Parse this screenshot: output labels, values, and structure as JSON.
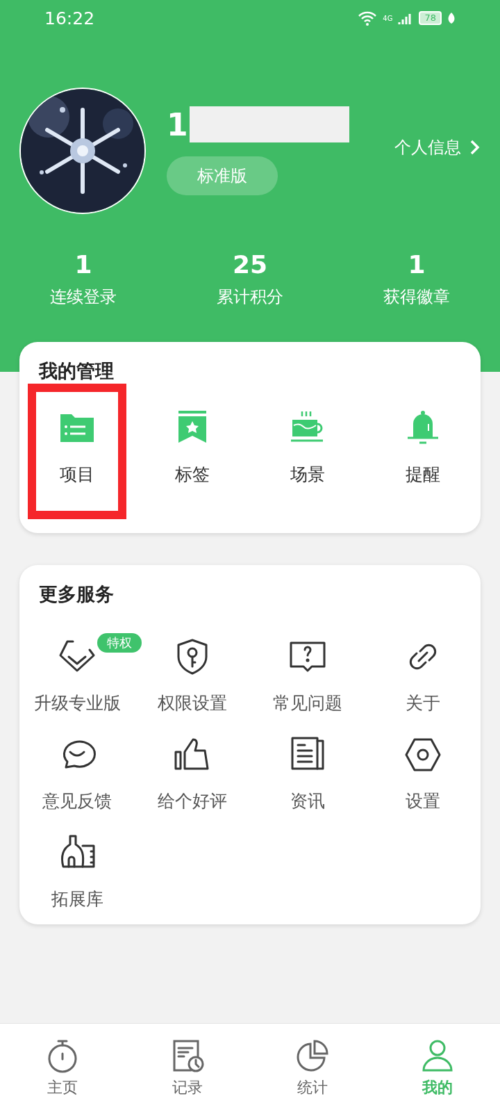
{
  "status_bar": {
    "time": "16:22",
    "network": "4G",
    "battery": "78"
  },
  "profile": {
    "name": "1",
    "edition": "标准版",
    "info_link": "个人信息"
  },
  "stats": [
    {
      "value": "1",
      "label": "连续登录"
    },
    {
      "value": "25",
      "label": "累计积分"
    },
    {
      "value": "1",
      "label": "获得徽章"
    }
  ],
  "management": {
    "title": "我的管理",
    "items": [
      {
        "kind": "folder",
        "label": "项目",
        "highlighted": true
      },
      {
        "kind": "bookmark",
        "label": "标签",
        "highlighted": false
      },
      {
        "kind": "cup",
        "label": "场景",
        "highlighted": false
      },
      {
        "kind": "bell",
        "label": "提醒",
        "highlighted": false
      }
    ]
  },
  "services": {
    "title": "更多服务",
    "items": [
      {
        "kind": "diamond",
        "label": "升级专业版",
        "badge": "特权"
      },
      {
        "kind": "shield",
        "label": "权限设置"
      },
      {
        "kind": "question",
        "label": "常见问题"
      },
      {
        "kind": "link",
        "label": "关于"
      },
      {
        "kind": "chat",
        "label": "意见反馈"
      },
      {
        "kind": "thumb",
        "label": "给个好评"
      },
      {
        "kind": "news",
        "label": "资讯"
      },
      {
        "kind": "hexagon",
        "label": "设置"
      },
      {
        "kind": "flask",
        "label": "拓展库"
      }
    ]
  },
  "tab_bar": [
    {
      "kind": "timer",
      "label": "主页",
      "selected": false
    },
    {
      "kind": "record",
      "label": "记录",
      "selected": false
    },
    {
      "kind": "pie",
      "label": "统计",
      "selected": false
    },
    {
      "kind": "person",
      "label": "我的",
      "selected": true
    }
  ]
}
